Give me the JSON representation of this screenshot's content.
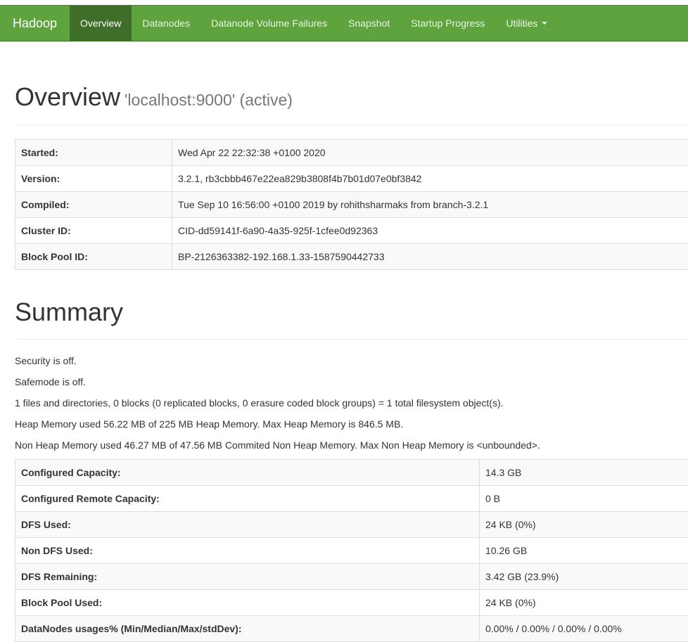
{
  "navbar": {
    "brand": "Hadoop",
    "items": [
      {
        "label": "Overview"
      },
      {
        "label": "Datanodes"
      },
      {
        "label": "Datanode Volume Failures"
      },
      {
        "label": "Snapshot"
      },
      {
        "label": "Startup Progress"
      },
      {
        "label": "Utilities"
      }
    ],
    "active_item": "Overview",
    "color": "#5fa33e"
  },
  "overview": {
    "title": "Overview",
    "subtitle": "'localhost:9000' (active)",
    "rows": [
      {
        "key": "Started:",
        "value": "Wed Apr 22 22:32:38 +0100 2020"
      },
      {
        "key": "Version:",
        "value": "3.2.1, rb3cbbb467e22ea829b3808f4b7b01d07e0bf3842"
      },
      {
        "key": "Compiled:",
        "value": "Tue Sep 10 16:56:00 +0100 2019 by rohithsharmaks from branch-3.2.1"
      },
      {
        "key": "Cluster ID:",
        "value": "CID-dd59141f-6a90-4a35-925f-1cfee0d92363"
      },
      {
        "key": "Block Pool ID:",
        "value": "BP-2126363382-192.168.1.33-1587590442733"
      }
    ]
  },
  "summary": {
    "title": "Summary",
    "lines": [
      "Security is off.",
      "Safemode is off.",
      "1 files and directories, 0 blocks (0 replicated blocks, 0 erasure coded block groups) = 1 total filesystem object(s).",
      "Heap Memory used 56.22 MB of 225 MB Heap Memory. Max Heap Memory is 846.5 MB.",
      "Non Heap Memory used 46.27 MB of 47.56 MB Commited Non Heap Memory. Max Non Heap Memory is <unbounded>."
    ],
    "rows": [
      {
        "key": "Configured Capacity:",
        "value": "14.3 GB"
      },
      {
        "key": "Configured Remote Capacity:",
        "value": "0 B"
      },
      {
        "key": "DFS Used:",
        "value": "24 KB (0%)"
      },
      {
        "key": "Non DFS Used:",
        "value": "10.26 GB"
      },
      {
        "key": "DFS Remaining:",
        "value": "3.42 GB (23.9%)"
      },
      {
        "key": "Block Pool Used:",
        "value": "24 KB (0%)"
      },
      {
        "key": "DataNodes usages% (Min/Median/Max/stdDev):",
        "value": "0.00% / 0.00% / 0.00% / 0.00%"
      }
    ]
  }
}
